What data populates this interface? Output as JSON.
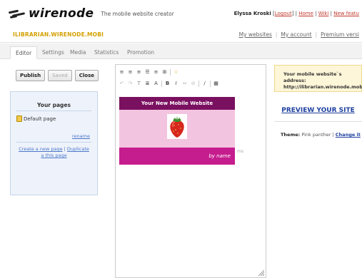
{
  "header": {
    "logo_text": "wirenode",
    "tagline": "The mobile website creator",
    "user_name": "Elyssa Kroski",
    "logout_label": "Logout",
    "home_label": "Home",
    "wiki_label": "Wiki",
    "new_features_label": "New featu"
  },
  "sitebar": {
    "site_url": "ILIBRARIAN.WIRENODE.MOBI",
    "links": [
      "My websites",
      "My account",
      "Premium versi"
    ]
  },
  "tabs": [
    "Editor",
    "Settings",
    "Media",
    "Statistics",
    "Promotion"
  ],
  "left_panel": {
    "buttons": [
      "Publish",
      "Saved",
      "Close"
    ],
    "pages_title": "Your pages",
    "pages": [
      "Default page"
    ],
    "rename_label": "rename",
    "create_page_label": "Create a new page",
    "duplicate_label": "Duplicate",
    "duplicate_label_2": "a this page"
  },
  "editor": {
    "toolbar_row1": [
      "≡",
      "≡",
      "≡",
      "☰",
      "≡",
      "⊞",
      "☆"
    ],
    "toolbar_row2": [
      "↶",
      "↷",
      "⊤",
      "≣",
      "A",
      "B",
      "I",
      "⇔",
      "⊘",
      "∕",
      "▦"
    ]
  },
  "preview": {
    "header_title": "Your New Mobile Website",
    "footer_text": "by name",
    "side_text": "ms",
    "header_color": "#7a1060",
    "body_color": "#f3c4df",
    "footer_color": "#c51d8e"
  },
  "right_panel": {
    "address_label": "Your mobile website`s address:",
    "address_url": "http://ilibrarian.wirenode.mobi",
    "preview_label": "PREVIEW YOUR SITE",
    "theme_label": "Theme:",
    "theme_name": "Pink panther",
    "change_theme_label": "Change it"
  }
}
